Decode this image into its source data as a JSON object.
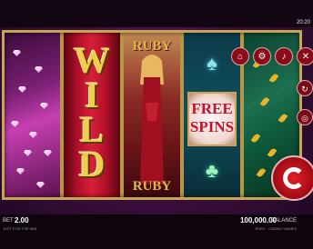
{
  "clock": "20:20",
  "reels": {
    "wild_text": "WILD",
    "ruby_top": "RUBY",
    "ruby_bottom": "RUBY",
    "free_spins_line1": "FREE",
    "free_spins_line2": "SPINS",
    "spade_icon": "♠",
    "club_icon": "♣"
  },
  "controls": {
    "home_icon": "home-icon",
    "settings_icon": "gear-icon",
    "sound_icon": "speaker-icon",
    "close_icon": "close-icon",
    "spin_icon": "spin-arrow-icon"
  },
  "footer": {
    "bet_label": "BET",
    "bet_value": "2.00",
    "bet_sub": "JUST FOR THE WIN",
    "balance_value": "100,000.00",
    "balance_label": "BALANCE",
    "balance_sub": "RUBY - CASINO GAMES"
  },
  "colors": {
    "accent_gold": "#c8a555",
    "spin_red": "#a00a14"
  }
}
